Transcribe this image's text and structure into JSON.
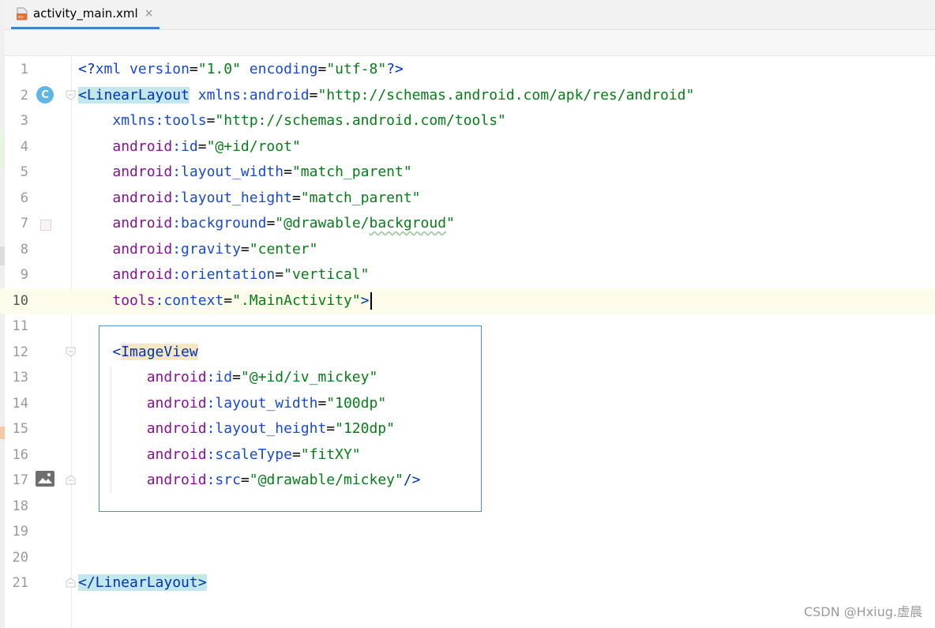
{
  "tab": {
    "label": "activity_main.xml",
    "icon": "xml-file-icon",
    "close": "×"
  },
  "gutter_icons": {
    "class": "C"
  },
  "lines": [
    {
      "n": "1",
      "tokens": [
        [
          "pi",
          "<?"
        ],
        [
          "attr",
          "xml "
        ],
        [
          "attr",
          "version"
        ],
        [
          "punct",
          "="
        ],
        [
          "val",
          "\"1.0\""
        ],
        [
          "punct",
          " "
        ],
        [
          "attr",
          "encoding"
        ],
        [
          "punct",
          "="
        ],
        [
          "val",
          "\"utf-8\""
        ],
        [
          "pi",
          "?>"
        ]
      ]
    },
    {
      "n": "2",
      "tokens": [
        [
          "tag-hl",
          "<LinearLayout"
        ],
        [
          "punct",
          " "
        ],
        [
          "attr",
          "xmlns:android"
        ],
        [
          "punct",
          "="
        ],
        [
          "val",
          "\"http://schemas.android.com/apk/res/android\""
        ]
      ]
    },
    {
      "n": "3",
      "tokens": [
        [
          "punct",
          "    "
        ],
        [
          "attr",
          "xmlns:tools"
        ],
        [
          "punct",
          "="
        ],
        [
          "val",
          "\"http://schemas.android.com/tools\""
        ]
      ]
    },
    {
      "n": "4",
      "tokens": [
        [
          "punct",
          "    "
        ],
        [
          "ns",
          "android"
        ],
        [
          "attr",
          ":id"
        ],
        [
          "punct",
          "="
        ],
        [
          "val",
          "\"@+id/root\""
        ]
      ]
    },
    {
      "n": "5",
      "tokens": [
        [
          "punct",
          "    "
        ],
        [
          "ns",
          "android"
        ],
        [
          "attr",
          ":layout_width"
        ],
        [
          "punct",
          "="
        ],
        [
          "val",
          "\"match_parent\""
        ]
      ]
    },
    {
      "n": "6",
      "tokens": [
        [
          "punct",
          "    "
        ],
        [
          "ns",
          "android"
        ],
        [
          "attr",
          ":layout_height"
        ],
        [
          "punct",
          "="
        ],
        [
          "val",
          "\"match_parent\""
        ]
      ]
    },
    {
      "n": "7",
      "tokens": [
        [
          "punct",
          "    "
        ],
        [
          "ns",
          "android"
        ],
        [
          "attr",
          ":background"
        ],
        [
          "punct",
          "="
        ],
        [
          "val",
          "\"@drawable/"
        ],
        [
          "val-sq",
          "backgroud"
        ],
        [
          "val",
          "\""
        ]
      ]
    },
    {
      "n": "8",
      "tokens": [
        [
          "punct",
          "    "
        ],
        [
          "ns",
          "android"
        ],
        [
          "attr",
          ":gravity"
        ],
        [
          "punct",
          "="
        ],
        [
          "val",
          "\"center\""
        ]
      ]
    },
    {
      "n": "9",
      "tokens": [
        [
          "punct",
          "    "
        ],
        [
          "ns",
          "android"
        ],
        [
          "attr",
          ":orientation"
        ],
        [
          "punct",
          "="
        ],
        [
          "val",
          "\"vertical\""
        ]
      ]
    },
    {
      "n": "10",
      "tokens": [
        [
          "punct",
          "    "
        ],
        [
          "ns",
          "tools"
        ],
        [
          "attr",
          ":context"
        ],
        [
          "punct",
          "="
        ],
        [
          "val",
          "\".MainActivity\""
        ],
        [
          "tag",
          ">"
        ]
      ]
    },
    {
      "n": "11",
      "tokens": []
    },
    {
      "n": "12",
      "tokens": [
        [
          "punct",
          "    "
        ],
        [
          "tag",
          "<"
        ],
        [
          "tag-hl2",
          "ImageView"
        ]
      ]
    },
    {
      "n": "13",
      "tokens": [
        [
          "punct",
          "        "
        ],
        [
          "ns",
          "android"
        ],
        [
          "attr",
          ":id"
        ],
        [
          "punct",
          "="
        ],
        [
          "val",
          "\"@+id/iv_mickey\""
        ]
      ]
    },
    {
      "n": "14",
      "tokens": [
        [
          "punct",
          "        "
        ],
        [
          "ns",
          "android"
        ],
        [
          "attr",
          ":layout_width"
        ],
        [
          "punct",
          "="
        ],
        [
          "val",
          "\"100dp\""
        ]
      ]
    },
    {
      "n": "15",
      "tokens": [
        [
          "punct",
          "        "
        ],
        [
          "ns",
          "android"
        ],
        [
          "attr",
          ":layout_height"
        ],
        [
          "punct",
          "="
        ],
        [
          "val",
          "\"120dp\""
        ]
      ]
    },
    {
      "n": "16",
      "tokens": [
        [
          "punct",
          "        "
        ],
        [
          "ns",
          "android"
        ],
        [
          "attr",
          ":scaleType"
        ],
        [
          "punct",
          "="
        ],
        [
          "val",
          "\"fitXY\""
        ]
      ]
    },
    {
      "n": "17",
      "tokens": [
        [
          "punct",
          "        "
        ],
        [
          "ns",
          "android"
        ],
        [
          "attr",
          ":src"
        ],
        [
          "punct",
          "="
        ],
        [
          "val",
          "\"@drawable/mickey\""
        ],
        [
          "tag",
          "/>"
        ]
      ]
    },
    {
      "n": "18",
      "tokens": []
    },
    {
      "n": "19",
      "tokens": []
    },
    {
      "n": "20",
      "tokens": []
    },
    {
      "n": "21",
      "tokens": [
        [
          "tag-hl",
          "</LinearLayout>"
        ]
      ]
    }
  ],
  "current_line": "10",
  "watermark": "CSDN @Hxiug.虚晨"
}
